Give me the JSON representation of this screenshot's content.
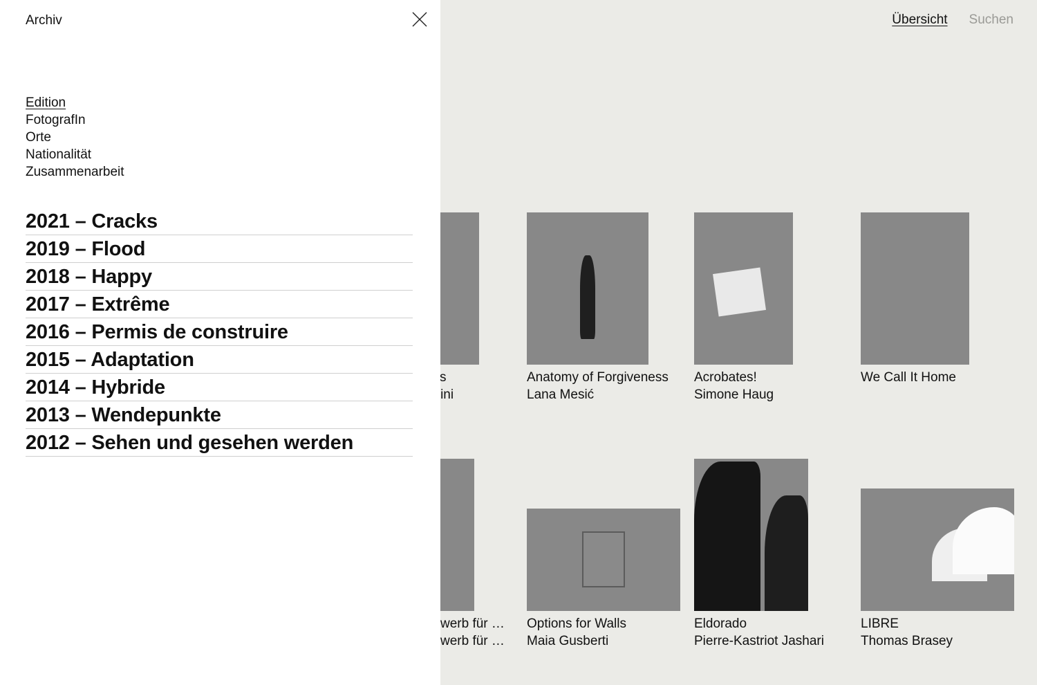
{
  "nav": {
    "overview": "Übersicht",
    "search": "Suchen"
  },
  "panel": {
    "title": "Archiv",
    "filters": [
      "Edition",
      "FotografIn",
      "Orte",
      "Nationalität",
      "Zusammenarbeit"
    ],
    "editions": [
      "2021 – Cracks",
      "2019 – Flood",
      "2018 – Happy",
      "2017 – Extrême",
      "2016 – Permis de construire",
      "2015 – Adaptation",
      "2014 – Hybride",
      "2013 – Wendepunkte",
      "2012 – Sehen und gesehen werden"
    ]
  },
  "works": [
    {
      "title": "cks",
      "artist": "avini"
    },
    {
      "title": "Anatomy of Forgiveness",
      "artist": "Lana Mesić"
    },
    {
      "title": "Acrobates!",
      "artist": "Simone Haug"
    },
    {
      "title": "We Call It Home",
      "artist": ""
    },
    {
      "title": "werb für …",
      "artist": "werb für …"
    },
    {
      "title": "Options for Walls",
      "artist": "Maia Gusberti"
    },
    {
      "title": "Eldorado",
      "artist": "Pierre-Kastriot Jashari"
    },
    {
      "title": "LIBRE",
      "artist": "Thomas Brasey"
    }
  ]
}
